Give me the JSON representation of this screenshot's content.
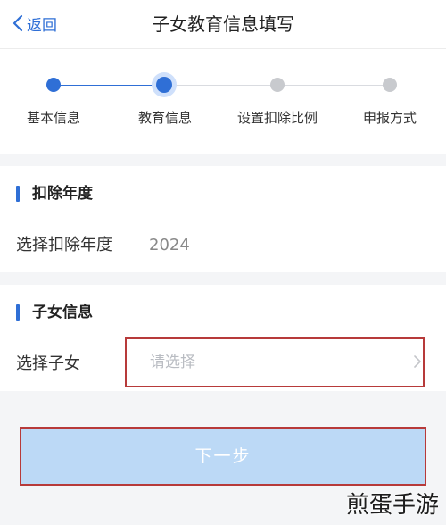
{
  "header": {
    "back_label": "返回",
    "title": "子女教育信息填写"
  },
  "steps": [
    {
      "label": "基本信息",
      "state": "done"
    },
    {
      "label": "教育信息",
      "state": "current"
    },
    {
      "label": "设置扣除比例",
      "state": "todo"
    },
    {
      "label": "申报方式",
      "state": "todo"
    }
  ],
  "deduction_year_section": {
    "title": "扣除年度",
    "row_label": "选择扣除年度",
    "row_value": "2024"
  },
  "children_section": {
    "title": "子女信息",
    "row_label": "选择子女",
    "placeholder": "请选择"
  },
  "next_button": {
    "label": "下一步"
  },
  "watermark": "煎蛋手游",
  "colors": {
    "accent": "#2f6fd6",
    "highlight_border": "#b73a3a",
    "button_disabled": "#bcd9f6"
  }
}
